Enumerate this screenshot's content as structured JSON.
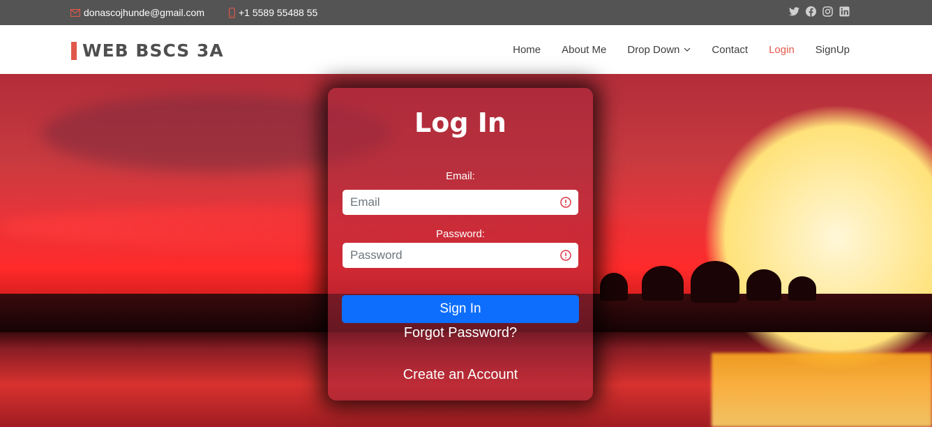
{
  "topbar": {
    "email": "donascojhunde@gmail.com",
    "phone": "+1 5589 55488 55",
    "social": [
      "twitter-icon",
      "facebook-icon",
      "instagram-icon",
      "linkedin-icon"
    ]
  },
  "header": {
    "logo": "WEB BSCS 3A",
    "nav": {
      "home": "Home",
      "about": "About Me",
      "dropdown": "Drop Down",
      "contact": "Contact",
      "login": "Login",
      "signup": "SignUp"
    }
  },
  "login": {
    "title": "Log In",
    "email_label": "Email:",
    "email_placeholder": "Email",
    "password_label": "Password:",
    "password_placeholder": "Password",
    "submit": "Sign In",
    "forgot": "Forgot Password?",
    "create": "Create an Account"
  },
  "colors": {
    "accent": "#e0584a",
    "topbar": "#545454",
    "primary_button": "#0d6efd",
    "warning_icon": "#dc3545"
  }
}
